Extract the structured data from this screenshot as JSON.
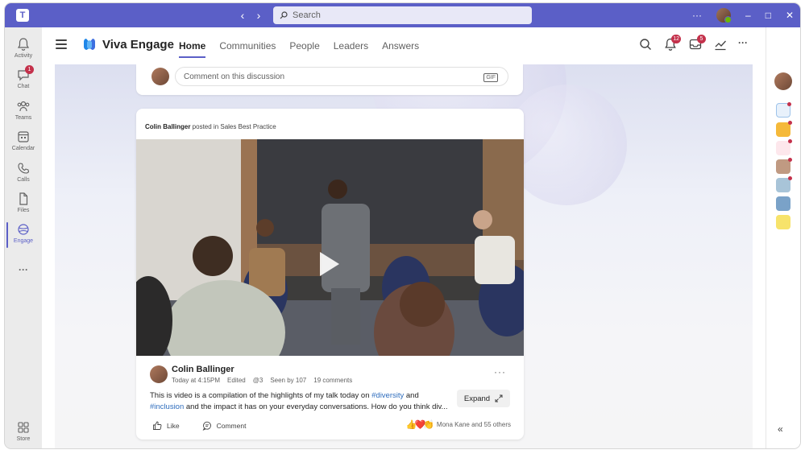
{
  "titlebar": {
    "search_placeholder": "Search",
    "more": "···",
    "minimize": "–",
    "maximize": "□",
    "close": "✕",
    "accent": "#5b5fc7"
  },
  "rail": {
    "items": [
      {
        "label": "Activity",
        "icon": "bell-icon"
      },
      {
        "label": "Chat",
        "icon": "chat-icon",
        "badge": "1"
      },
      {
        "label": "Teams",
        "icon": "teams-icon"
      },
      {
        "label": "Calendar",
        "icon": "calendar-icon"
      },
      {
        "label": "Calls",
        "icon": "phone-icon"
      },
      {
        "label": "Files",
        "icon": "file-icon"
      },
      {
        "label": "Engage",
        "icon": "engage-icon",
        "active": true
      }
    ],
    "more": "···",
    "store_label": "Store"
  },
  "topnav": {
    "brand": "Viva Engage",
    "tabs": [
      "Home",
      "Communities",
      "People",
      "Leaders",
      "Answers"
    ],
    "active_tab": "Home",
    "notifications_badge": "12",
    "inbox_badge": "5",
    "more": "···"
  },
  "comment_box": {
    "placeholder": "Comment on this discussion",
    "gif_label": "GIF"
  },
  "post": {
    "header_author": "Colin Ballinger",
    "header_text": " posted in Sales Best Practice",
    "author": "Colin Ballinger",
    "meta": {
      "time": "Today at 4:15PM",
      "edited": "Edited",
      "mentions": "@3",
      "seen": "Seen by 107",
      "comments": "19 comments"
    },
    "body_1": "This is video is a compilation of the highlights of my talk today on ",
    "tag_1": "#diversity",
    "body_2": " and ",
    "tag_2": "#inclusion",
    "body_3": " and the impact it has on your everyday conversations. How do you think div...",
    "expand_label": "Expand",
    "like_label": "Like",
    "comment_label": "Comment",
    "reactions_text": "Mona Kane and 55 others",
    "more": "···"
  },
  "right_rail": {
    "collapse": "«"
  }
}
